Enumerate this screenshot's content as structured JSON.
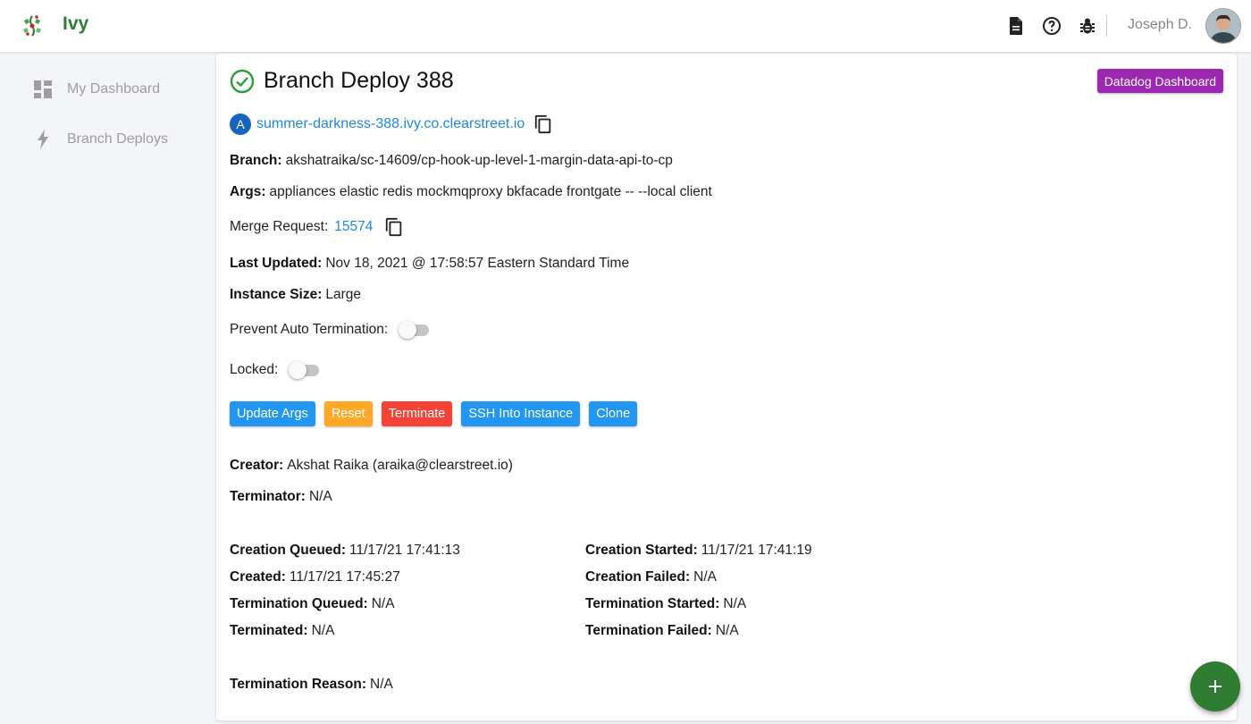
{
  "app": {
    "name": "Ivy"
  },
  "header": {
    "user_name": "Joseph D."
  },
  "sidebar": {
    "items": [
      {
        "label": "My Dashboard",
        "icon": "dashboard-icon"
      },
      {
        "label": "Branch Deploys",
        "icon": "lightning-icon"
      }
    ]
  },
  "deploy": {
    "title": "Branch Deploy 388",
    "status": "success",
    "datadog_label": "Datadog Dashboard",
    "url_avatar_letter": "A",
    "url": "summer-darkness-388.ivy.co.clearstreet.io",
    "branch_label": "Branch:",
    "branch": "akshatraika/sc-14609/cp-hook-up-level-1-margin-data-api-to-cp",
    "args_label": "Args:",
    "args": "appliances elastic redis mockmqproxy bkfacade frontgate -- --local client",
    "merge_request_label": "Merge Request:",
    "merge_request": "15574",
    "last_updated_label": "Last Updated:",
    "last_updated": "Nov 18, 2021 @ 17:58:57 Eastern Standard Time",
    "instance_size_label": "Instance Size:",
    "instance_size": "Large",
    "prevent_auto_termination_label": "Prevent Auto Termination:",
    "prevent_auto_termination": false,
    "locked_label": "Locked:",
    "locked": false,
    "creator_label": "Creator:",
    "creator": "Akshat Raika (araika@clearstreet.io)",
    "terminator_label": "Terminator:",
    "terminator": "N/A",
    "creation_queued_label": "Creation Queued:",
    "creation_queued": "11/17/21 17:41:13",
    "creation_started_label": "Creation Started:",
    "creation_started": "11/17/21 17:41:19",
    "created_label": "Created:",
    "created": "11/17/21 17:45:27",
    "creation_failed_label": "Creation Failed:",
    "creation_failed": "N/A",
    "termination_queued_label": "Termination Queued:",
    "termination_queued": "N/A",
    "termination_started_label": "Termination Started:",
    "termination_started": "N/A",
    "terminated_label": "Terminated:",
    "terminated": "N/A",
    "termination_failed_label": "Termination Failed:",
    "termination_failed": "N/A",
    "termination_reason_label": "Termination Reason:",
    "termination_reason": "N/A"
  },
  "actions": {
    "update_args": "Update Args",
    "reset": "Reset",
    "terminate": "Terminate",
    "ssh": "SSH Into Instance",
    "clone": "Clone"
  },
  "colors": {
    "brand": "#2e7d32",
    "link": "#1e88e5",
    "primary": "#2196f3",
    "warning": "#ffa726",
    "danger": "#f44336",
    "datadog": "#9c27b0"
  }
}
